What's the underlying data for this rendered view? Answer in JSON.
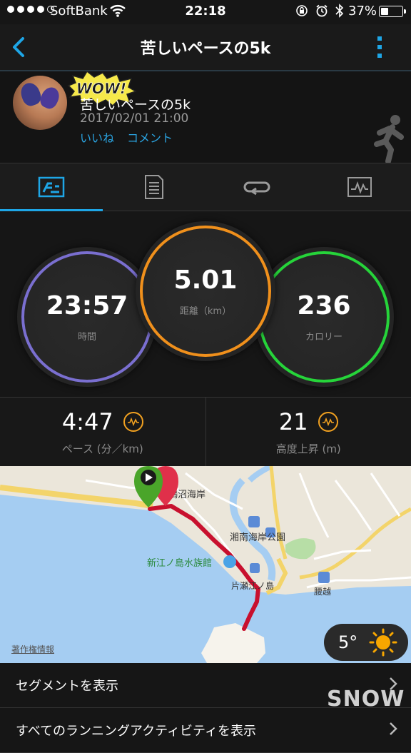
{
  "status_bar": {
    "carrier": "SoftBank",
    "time": "22:18",
    "battery": "37%",
    "battery_level": 0.37
  },
  "nav": {
    "title": "苦しいペースの5k"
  },
  "activity": {
    "sticker": "WOW!",
    "name": "苦しいペースの5k",
    "date": "2017/02/01 21:00",
    "like": "いいね",
    "comment": "コメント"
  },
  "tabs": [
    {
      "icon": "stats-icon",
      "active": true
    },
    {
      "icon": "details-icon",
      "active": false
    },
    {
      "icon": "laps-icon",
      "active": false
    },
    {
      "icon": "chart-icon",
      "active": false
    }
  ],
  "stats": {
    "time": {
      "value": "23:57",
      "label": "時間",
      "color": "#7a6fd0"
    },
    "distance": {
      "value": "5.01",
      "label": "距離（km）",
      "color": "#f0901c"
    },
    "calories": {
      "value": "236",
      "label": "カロリー",
      "color": "#26d43a"
    }
  },
  "metrics": {
    "pace": {
      "value": "4:47",
      "label": "ペース (分／km)"
    },
    "elevation": {
      "value": "21",
      "label": "高度上昇 (m)"
    }
  },
  "map": {
    "labels": {
      "beach": "鵠沼海岸",
      "park": "湘南海岸公園",
      "aquarium": "新江ノ島水族館",
      "station": "片瀬江ノ島",
      "koshigoe": "腰越"
    },
    "copyright": "著作権情報",
    "weather_temp": "5°"
  },
  "list": {
    "segments": "セグメントを表示",
    "all_activities": "すべてのランニングアクティビティを表示"
  },
  "watermark": "SNOW",
  "colors": {
    "accent": "#1ea6e6",
    "route": "#c8102e"
  }
}
